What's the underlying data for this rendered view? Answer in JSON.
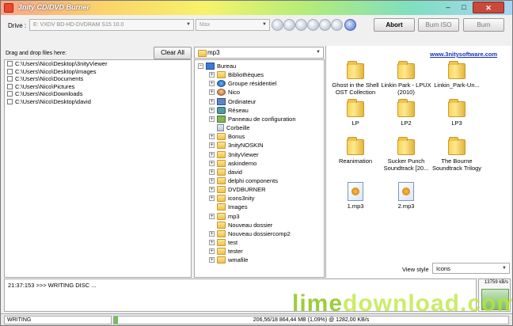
{
  "window": {
    "title": "3nity CD/DVD Burner",
    "min": "–",
    "max": "□",
    "close": "✕"
  },
  "toolbar": {
    "drive_label": "Drive :",
    "drive_value": "E: VXDV      BD-HD-DVDRAM S15 10.0",
    "speed_value": "Max",
    "abort_label": "Abort",
    "burn_iso_label": "Burn ISO",
    "burn_label": "Burn",
    "tool_icons": [
      "disc-icon",
      "disc-erase-icon",
      "disc-copy-icon",
      "disc-eject-icon",
      "disc-close-icon",
      "disc-info-icon",
      "info-icon"
    ]
  },
  "left_pane": {
    "drag_label": "Drag and drop files here:",
    "clear_all_label": "Clear All",
    "files": [
      "C:\\Users\\Nico\\Desktop\\3nityViewer",
      "C:\\Users\\Nico\\Desktop\\Images",
      "C:\\Users\\Nico\\Documents",
      "C:\\Users\\Nico\\Pictures",
      "C:\\Users\\Nico\\Downloads",
      "C:\\Users\\Nico\\Desktop\\david"
    ]
  },
  "tree_pane": {
    "path_value": "mp3",
    "items": [
      {
        "label": "Bureau",
        "depth": 0,
        "expander": "−",
        "icon": "desktop-icon"
      },
      {
        "label": "Bibliothèques",
        "depth": 1,
        "expander": "+",
        "icon": "folder-icon"
      },
      {
        "label": "Groupe résidentiel",
        "depth": 1,
        "expander": "+",
        "icon": "homegroup-icon"
      },
      {
        "label": "Nico",
        "depth": 1,
        "expander": "+",
        "icon": "user-icon"
      },
      {
        "label": "Ordinateur",
        "depth": 1,
        "expander": "+",
        "icon": "computer-icon"
      },
      {
        "label": "Réseau",
        "depth": 1,
        "expander": "+",
        "icon": "network-icon"
      },
      {
        "label": "Panneau de configuration",
        "depth": 1,
        "expander": "+",
        "icon": "control-panel-icon"
      },
      {
        "label": "Corbeille",
        "depth": 1,
        "expander": "",
        "icon": "recycle-bin-icon"
      },
      {
        "label": "Bonus",
        "depth": 1,
        "expander": "+",
        "icon": "folder-icon"
      },
      {
        "label": "3nityNOSKIN",
        "depth": 1,
        "expander": "+",
        "icon": "folder-icon"
      },
      {
        "label": "3nityViewer",
        "depth": 1,
        "expander": "+",
        "icon": "folder-icon"
      },
      {
        "label": "askindemo",
        "depth": 1,
        "expander": "+",
        "icon": "folder-icon"
      },
      {
        "label": "david",
        "depth": 1,
        "expander": "+",
        "icon": "folder-icon"
      },
      {
        "label": "delphi components",
        "depth": 1,
        "expander": "+",
        "icon": "folder-icon"
      },
      {
        "label": "DVDBURNER",
        "depth": 1,
        "expander": "+",
        "icon": "folder-icon"
      },
      {
        "label": "icons3nity",
        "depth": 1,
        "expander": "+",
        "icon": "folder-icon"
      },
      {
        "label": "Images",
        "depth": 1,
        "expander": "",
        "icon": "folder-icon"
      },
      {
        "label": "mp3",
        "depth": 1,
        "expander": "+",
        "icon": "folder-icon"
      },
      {
        "label": "Nouveau dossier",
        "depth": 1,
        "expander": "",
        "icon": "folder-icon"
      },
      {
        "label": "Nouveau dossiercomp2",
        "depth": 1,
        "expander": "+",
        "icon": "folder-icon"
      },
      {
        "label": "test",
        "depth": 1,
        "expander": "+",
        "icon": "folder-icon"
      },
      {
        "label": "tester",
        "depth": 1,
        "expander": "+",
        "icon": "folder-icon"
      },
      {
        "label": "wmafile",
        "depth": 1,
        "expander": "+",
        "icon": "folder-icon"
      }
    ]
  },
  "view_pane": {
    "link": "www.3nitysoftware.com",
    "items": [
      {
        "label": "Ghost in the Shell OST Collection",
        "type": "folder"
      },
      {
        "label": "Linkin Park - LPUX (2010)",
        "type": "folder"
      },
      {
        "label": "Linkin_Park-Un...",
        "type": "folder"
      },
      {
        "label": "LP",
        "type": "folder"
      },
      {
        "label": "LP2",
        "type": "folder"
      },
      {
        "label": "LP3",
        "type": "folder"
      },
      {
        "label": "Reanimation",
        "type": "folder"
      },
      {
        "label": "Sucker Punch Soundtrack [20...",
        "type": "folder"
      },
      {
        "label": "The Bourne Soundtrack Trilogy",
        "type": "folder"
      },
      {
        "label": "1.mp3",
        "type": "mp3"
      },
      {
        "label": "2.mp3",
        "type": "mp3"
      }
    ],
    "view_style_label": "View style",
    "view_style_value": "Icons"
  },
  "log": {
    "line": "21:37:153 >>> WRITING DISC ..."
  },
  "speed_box": {
    "value": "13759 kB/s"
  },
  "status": {
    "left": "WRITING",
    "progress_text": "206,56/18 864,44 MB (1,09%) @ 1282,00 KB/s",
    "progress_fraction": 0.0109
  },
  "watermark": {
    "part1": "lime",
    "part2": "download.com"
  }
}
